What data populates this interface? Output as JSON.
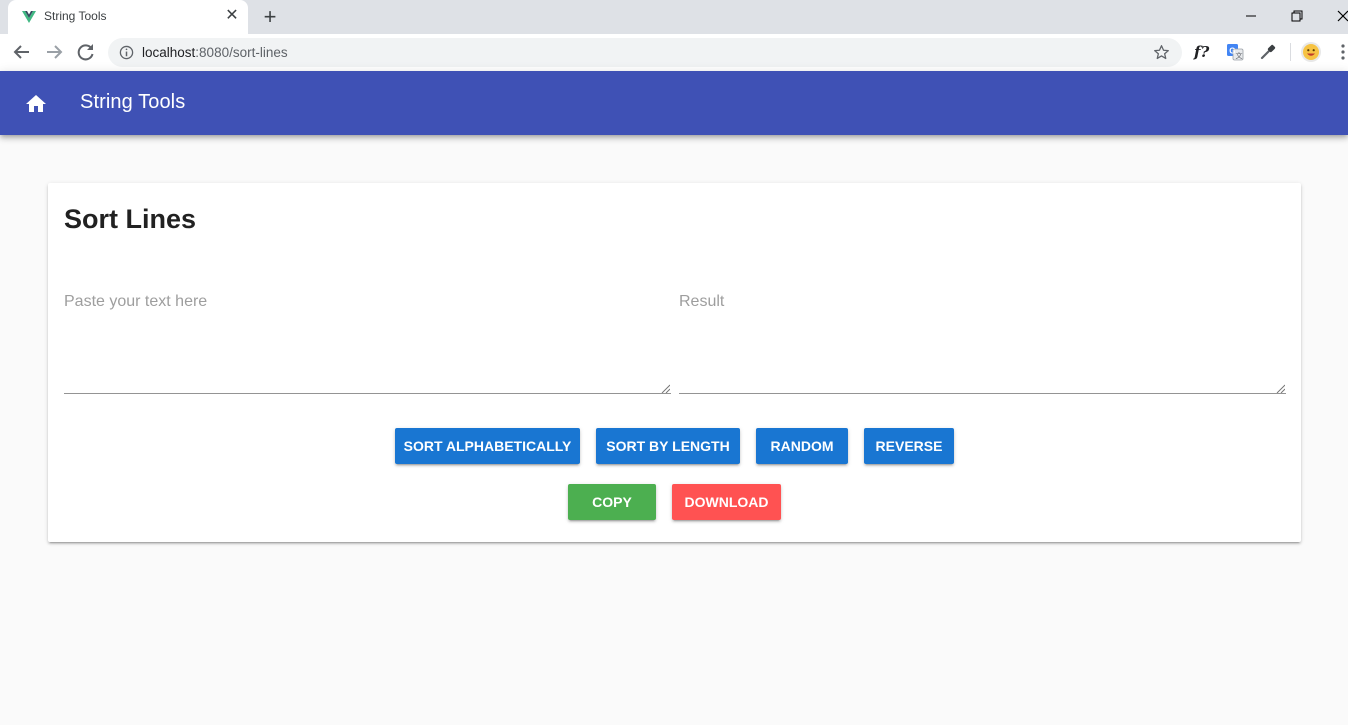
{
  "browser": {
    "tab_title": "String Tools",
    "url_host": "localhost",
    "url_path": ":8080/sort-lines",
    "extension_f_label": "f?"
  },
  "app": {
    "title": "String Tools",
    "primary_color": "#3f51b5"
  },
  "page": {
    "title": "Sort Lines",
    "input_placeholder": "Paste your text here",
    "result_placeholder": "Result",
    "buttons": {
      "sort_alphabetically": "SORT ALPHABETICALLY",
      "sort_by_length": "SORT BY LENGTH",
      "random": "RANDOM",
      "reverse": "REVERSE",
      "copy": "COPY",
      "download": "DOWNLOAD"
    },
    "colors": {
      "action_blue": "#1976d2",
      "copy_green": "#4caf50",
      "download_red": "#ff5252"
    }
  }
}
